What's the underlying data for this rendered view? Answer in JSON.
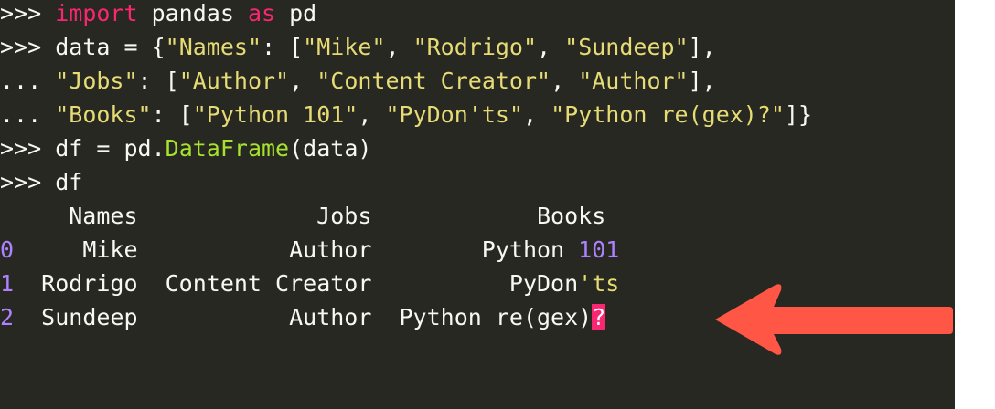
{
  "terminal": {
    "background": "#272822",
    "session": {
      "l1": {
        "prompt": ">>> ",
        "kw_import": "import",
        "t1": " pandas ",
        "kw_as": "as",
        "t2": " pd"
      },
      "l2": {
        "prompt": ">>> ",
        "t1": "data = {",
        "s1": "\"Names\"",
        "t2": ": [",
        "s2": "\"Mike\"",
        "t3": ", ",
        "s3": "\"Rodrigo\"",
        "t4": ", ",
        "s4": "\"Sundeep\"",
        "t5": "],"
      },
      "l3": {
        "prompt": "... ",
        "s1": "\"Jobs\"",
        "t1": ": [",
        "s2": "\"Author\"",
        "t2": ", ",
        "s3": "\"Content Creator\"",
        "t3": ", ",
        "s4": "\"Author\"",
        "t4": "],"
      },
      "l4": {
        "prompt": "... ",
        "s1": "\"Books\"",
        "t1": ": [",
        "s2": "\"Python 101\"",
        "t2": ", ",
        "s3": "\"PyDon'ts\"",
        "t3": ", ",
        "s4": "\"Python re(gex)?\"",
        "t4": "]}"
      },
      "l5": {
        "prompt": ">>> ",
        "t1": "df = pd.",
        "call": "DataFrame",
        "t2": "(data)"
      },
      "l6": {
        "prompt": ">>> ",
        "t1": "df"
      }
    },
    "table": {
      "header": "     Names             Jobs            Books",
      "rows": [
        {
          "index": "0",
          "a": "     Mike           Author        Python ",
          "b": "101",
          "c": ""
        },
        {
          "index": "1",
          "a": "  Rodrigo  Content Creator          PyDon",
          "b": "'ts",
          "c": ""
        },
        {
          "index": "2",
          "a": "  Sundeep           Author  Python re(gex)",
          "b": "?",
          "c": ""
        }
      ]
    },
    "colors": {
      "keyword": "#f92672",
      "string": "#e6db74",
      "function": "#a6e22e",
      "number": "#ae81ff",
      "highlight": "#f92672",
      "arrow": "#ff5645"
    }
  },
  "annotation": {
    "icon": "red-arrow-icon"
  }
}
